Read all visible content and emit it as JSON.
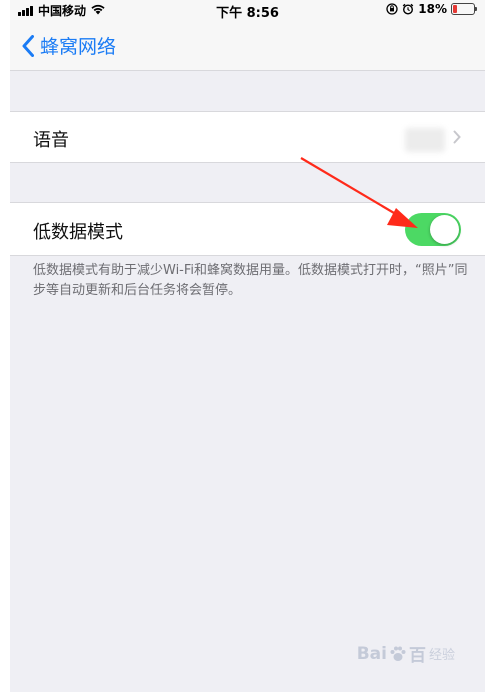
{
  "status_bar": {
    "carrier": "中国移动",
    "time": "下午 8:56",
    "battery_percent": "18%",
    "battery_level": 0.18,
    "battery_color": "#e53935",
    "icons": [
      "signal-icon",
      "wifi-icon",
      "orientation-lock-icon",
      "alarm-icon",
      "battery-icon"
    ]
  },
  "nav": {
    "back_label": "蜂窝网络",
    "back_icon": "chevron-left-icon",
    "accent_color": "#1b7cf5"
  },
  "rows": {
    "voice": {
      "label": "语音"
    },
    "low_data": {
      "label": "低数据模式",
      "enabled": true,
      "toggle_color": "#4cd964"
    }
  },
  "footer": {
    "text": "低数据模式有助于减少Wi-Fi和蜂窝数据用量。低数据模式打开时，“照片”同步等自动更新和后台任务将会暂停。"
  },
  "annotation": {
    "arrow_color": "#ff2a1a"
  },
  "watermark": {
    "brand": "Bai",
    "brand_end": "百",
    "sub": "经验"
  }
}
